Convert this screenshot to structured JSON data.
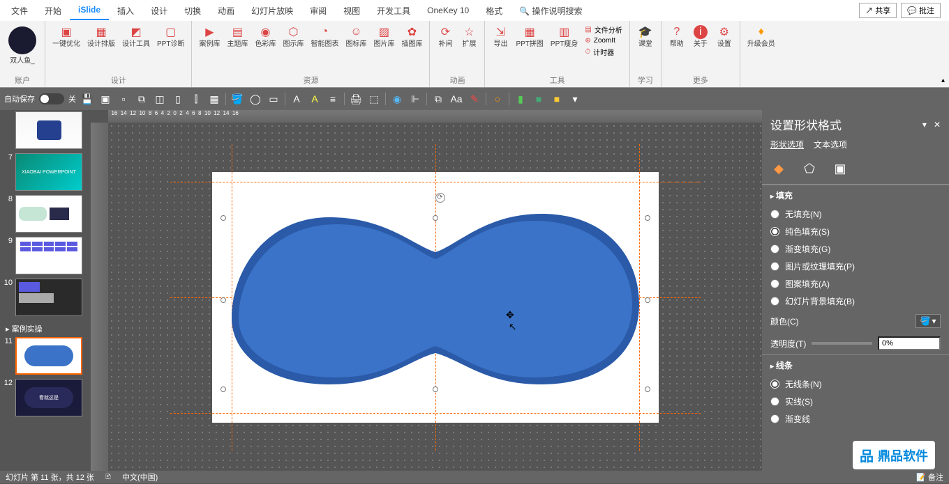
{
  "ribbon": {
    "tabs": [
      "文件",
      "开始",
      "iSlide",
      "插入",
      "设计",
      "切换",
      "动画",
      "幻灯片放映",
      "审阅",
      "视图",
      "开发工具",
      "OneKey 10",
      "格式"
    ],
    "active_tab": "iSlide",
    "search_hint": "操作说明搜索",
    "share": "共享",
    "comment": "批注",
    "account_name": "双人鱼_",
    "groups": {
      "account": "账户",
      "design": "设计",
      "resource": "资源",
      "anim": "动画",
      "tools": "工具",
      "study": "学习",
      "more": "更多"
    },
    "buttons": {
      "opt": "一键优化",
      "layout": "设计排版",
      "dtool": "设计工具",
      "pptdiag": "PPT诊断",
      "case": "案例库",
      "theme": "主题库",
      "color": "色彩库",
      "diagram": "图示库",
      "chart": "智能图表",
      "icon": "图标库",
      "image": "图片库",
      "illust": "插图库",
      "tween": "补间",
      "ext": "扩展",
      "export": "导出",
      "pptpin": "PPT拼图",
      "pptslim": "PPT瘦身",
      "fileanal": "文件分析",
      "zoomit": "ZoomIt",
      "timer": "计时器",
      "class": "课堂",
      "help": "帮助",
      "about": "关于",
      "settings": "设置",
      "upgrade": "升级会员"
    }
  },
  "qat": {
    "autosave": "自动保存",
    "off": "关"
  },
  "thumbs": {
    "section": "案例实操",
    "nums": [
      "7",
      "8",
      "9",
      "10",
      "11",
      "12"
    ],
    "t7text": "XIAOBAI POWERPOINT",
    "t12text": "看就这是"
  },
  "panel": {
    "title": "设置形状格式",
    "tab_shape": "形状选项",
    "tab_text": "文本选项",
    "sec_fill": "填充",
    "sec_line": "线条",
    "fill_options": [
      "无填充(N)",
      "纯色填充(S)",
      "渐变填充(G)",
      "图片或纹理填充(P)",
      "图案填充(A)",
      "幻灯片背景填充(B)"
    ],
    "fill_selected": 1,
    "color_label": "颜色(C)",
    "trans_label": "透明度(T)",
    "trans_value": "0%",
    "line_options": [
      "无线条(N)",
      "实线(S)",
      "渐变线"
    ],
    "line_selected": 0
  },
  "status": {
    "slide_info": "幻灯片 第 11 张，共 12 张",
    "lang": "中文(中国)",
    "notes": "备注"
  },
  "watermark": "鼎品软件"
}
